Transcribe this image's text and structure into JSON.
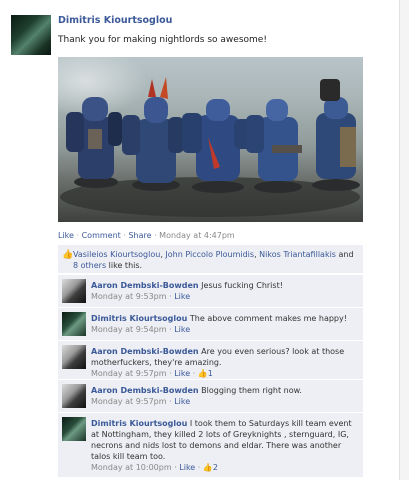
{
  "post": {
    "author": "Dimitris Kiourtsoglou",
    "text": "Thank you for making nightlords so awesome!",
    "actions": {
      "like": "Like",
      "comment": "Comment",
      "share": "Share",
      "timestamp": "Monday at 4:47pm"
    }
  },
  "likes": {
    "names": [
      "Vasileios Kiourtsoglou",
      "John Piccolo Ploumidis",
      "Nikos Triantafillakis"
    ],
    "separator": ", ",
    "and_word": "and",
    "others": "8 others",
    "suffix": "like this."
  },
  "comments": [
    {
      "author": "Aaron Dembski-Bowden",
      "text": "Jesus fucking Christ!",
      "time": "Monday at 9:53pm",
      "like": "Like",
      "likes": "",
      "avatar": "aaron"
    },
    {
      "author": "Dimitris Kiourtsoglou",
      "text": "The above comment makes me happy!",
      "time": "Monday at 9:54pm",
      "like": "Like",
      "likes": "",
      "avatar": "dimitris"
    },
    {
      "author": "Aaron Dembski-Bowden",
      "text": "Are you even serious? look at those motherfuckers, they're amazing.",
      "time": "Monday at 9:57pm",
      "like": "Like",
      "likes": "1",
      "avatar": "aaron"
    },
    {
      "author": "Aaron Dembski-Bowden",
      "text": "Blogging them right now.",
      "time": "Monday at 9:57pm",
      "like": "Like",
      "likes": "",
      "avatar": "aaron"
    },
    {
      "author": "Dimitris Kiourtsoglou",
      "text": "I took them to Saturdays kill team event at Nottingham, they killed 2 lots of Greyknights , sternguard, IG, necrons and nids lost to demons and eldar. There was another talos kill team too.",
      "time": "Monday at 10:00pm",
      "like": "Like",
      "likes": "2",
      "avatar": "dimitris"
    }
  ],
  "ui": {
    "dot": "·",
    "thumb_glyph": "👍"
  }
}
